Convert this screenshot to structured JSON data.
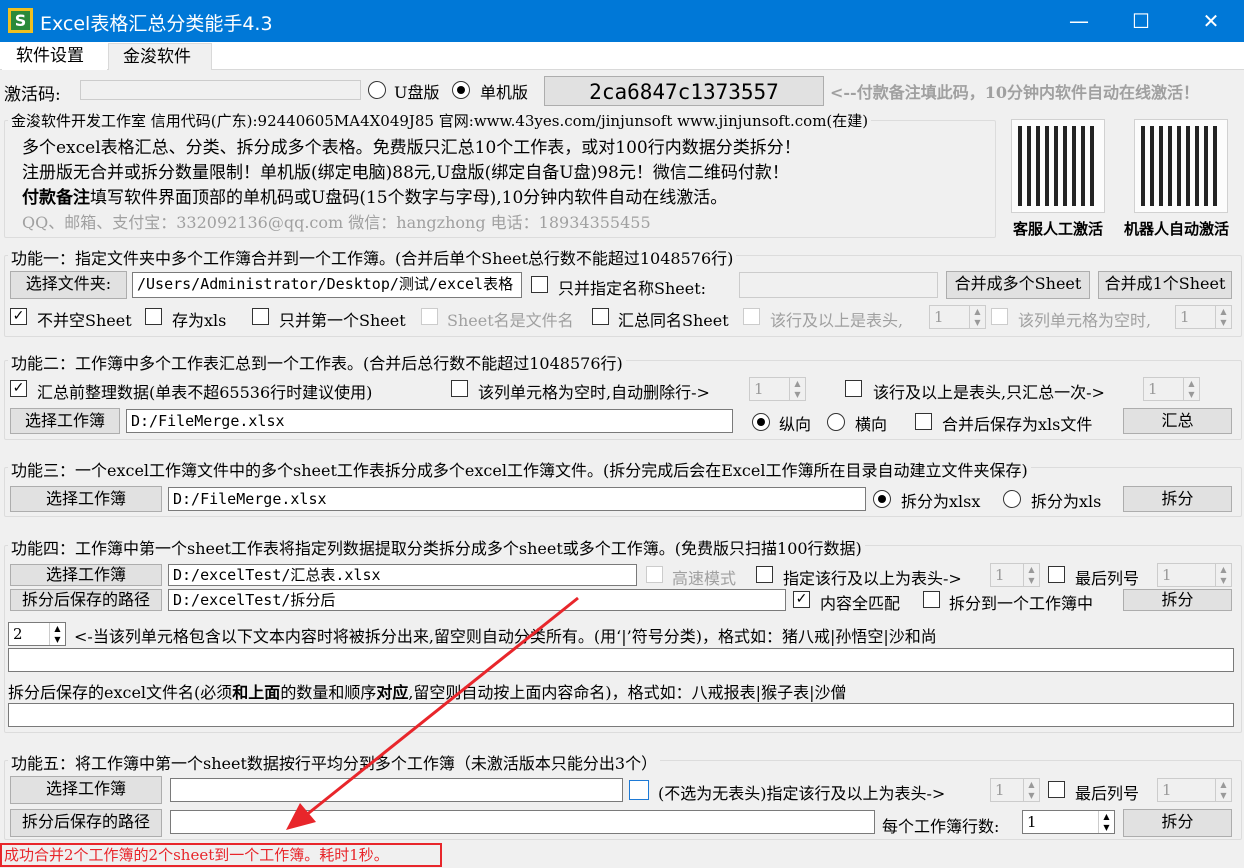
{
  "window": {
    "title": "Excel表格汇总分类能手4.3",
    "minimize": "—",
    "maximize": "☐",
    "close": "✕",
    "logo": "S"
  },
  "tabs": [
    {
      "label": "软件设置",
      "active": true
    },
    {
      "label": "金浚软件",
      "active": false
    }
  ],
  "activation": {
    "label": "激活码:",
    "value": "",
    "udisk_label": "U盘版",
    "single_label": "单机版",
    "selected": "单机版",
    "machine_code": "2ca6847c1373557",
    "notice": "<--付款备注填此码，10分钟内软件自动在线激活！"
  },
  "info": {
    "legend": "金浚软件开发工作室 信用代码(广东):92440605MA4X049J85 官网:www.43yes.com/jinjunsoft  www.jinjunsoft.com(在建)",
    "line1": "多个excel表格汇总、分类、拆分成多个表格。免费版只汇总10个工作表，或对100行内数据分类拆分！",
    "line2": "注册版无合并或拆分数量限制！单机版(绑定电脑)88元,U盘版(绑定自备U盘)98元！微信二维码付款！",
    "line3_bold": "付款备注",
    "line3": "填写软件界面顶部的单机码或U盘码(15个数字与字母),10分钟内软件自动在线激活。",
    "contact": "QQ、邮箱、支付宝：332092136@qq.com  微信：hangzhong  电话：18934355455",
    "qr1_label": "客服人工激活",
    "qr2_label": "机器人自动激活"
  },
  "f1": {
    "legend": "功能一：指定文件夹中多个工作簿合并到一个工作簿。(合并后单个Sheet总行数不能超过1048576行)",
    "choose_folder": "选择文件夹:",
    "folder": "/Users/Administrator/Desktop/测试/excel表格",
    "only_named": "只并指定名称Sheet:",
    "sheet_name": "",
    "merge_multi": "合并成多个Sheet",
    "merge_one": "合并成1个Sheet",
    "skip_empty": "不并空Sheet",
    "save_xls": "存为xls",
    "first_only": "只并第一个Sheet",
    "sheet_is_filename": "Sheet名是文件名",
    "sum_same": "汇总同名Sheet",
    "header_rows": "该行及以上是表头,",
    "header_val": "1",
    "empty_col": "该列单元格为空时,",
    "empty_val": "1"
  },
  "f2": {
    "legend": "功能二：工作簿中多个工作表汇总到一个工作表。(合并后总行数不能超过1048576行)",
    "tidy": "汇总前整理数据(单表不超65536行时建议使用)",
    "del_empty": "该列单元格为空时,自动删除行->",
    "del_val": "1",
    "header_once": "该行及以上是表头,只汇总一次->",
    "header_val": "1",
    "choose": "选择工作簿",
    "file": "D:/FileMerge.xlsx",
    "vertical": "纵向",
    "horizontal": "横向",
    "save_xls": "合并后保存为xls文件",
    "run": "汇总"
  },
  "f3": {
    "legend": "功能三：一个excel工作簿文件中的多个sheet工作表拆分成多个excel工作簿文件。(拆分完成后会在Excel工作簿所在目录自动建立文件夹保存)",
    "choose": "选择工作簿",
    "file": "D:/FileMerge.xlsx",
    "xlsx": "拆分为xlsx",
    "xls": "拆分为xls",
    "run": "拆分"
  },
  "f4": {
    "legend": "功能四：工作簿中第一个sheet工作表将指定列数据提取分类拆分成多个sheet或多个工作簿。(免费版只扫描100行数据)",
    "choose": "选择工作簿",
    "file": "D:/excelTest/汇总表.xlsx",
    "fast": "高速模式",
    "header": "指定该行及以上为表头->",
    "header_val": "1",
    "last_col": "最后列号",
    "last_val": "1",
    "save_path_btn": "拆分后保存的路径",
    "save_path": "D:/excelTest/拆分后",
    "full_match": "内容全匹配",
    "to_one": "拆分到一个工作簿中",
    "run": "拆分",
    "col_val": "2",
    "col_hint": "<-当该列单元格包含以下文本内容时将被拆分出来,留空则自动分类所有。(用‘|’符号分类)，格式如：猪八戒|孙悟空|沙和尚",
    "keywords": "",
    "names_hint_a": "拆分后保存的excel文件名(必须",
    "names_hint_b": "和上面",
    "names_hint_c": "的数量和顺序",
    "names_hint_d": "对应",
    "names_hint_e": ",留空则自动按上面内容命名)，格式如：八戒报表|猴子表|沙僧",
    "names": ""
  },
  "f5": {
    "legend": "功能五：将工作簿中第一个sheet数据按行平均分到多个工作簿（未激活版本只能分出3个）",
    "choose": "选择工作簿",
    "file": "",
    "header": "(不选为无表头)指定该行及以上为表头->",
    "header_val": "1",
    "last_col": "最后列号",
    "last_val": "1",
    "save_path_btn": "拆分后保存的路径",
    "save_path": "",
    "rows_label": "每个工作簿行数:",
    "rows_val": "1",
    "run": "拆分"
  },
  "status": {
    "text": "成功合并2个工作簿的2个sheet到一个工作簿。耗时1秒。",
    "color": "#e8262b"
  }
}
